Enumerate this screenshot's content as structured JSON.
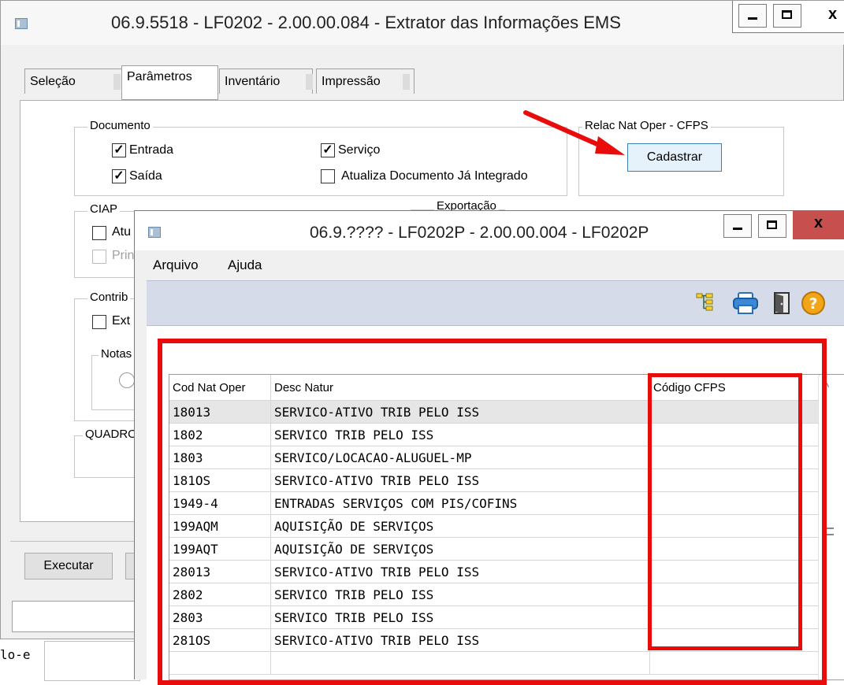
{
  "main_window": {
    "title": "06.9.5518 - LF0202 - 2.00.00.084 - Extrator das Informações EMS",
    "tabs": [
      {
        "label": "Seleção"
      },
      {
        "label": "Parâmetros"
      },
      {
        "label": "Inventário"
      },
      {
        "label": "Impressão"
      }
    ],
    "active_tab": "Parâmetros",
    "documento": {
      "legend": "Documento",
      "entrada": "Entrada",
      "saida": "Saída",
      "servico": "Serviço",
      "atualiza": "Atualiza Documento Já Integrado"
    },
    "relac": {
      "legend": "Relac Nat Oper - CFPS",
      "button": "Cadastrar"
    },
    "ciap": {
      "legend": "CIAP",
      "item1": "Atu",
      "item2": "Prin"
    },
    "exportacao": {
      "legend": "Exportação"
    },
    "contrib": {
      "legend": "Contrib",
      "item1": "Ext",
      "notas": "Notas"
    },
    "quadro": {
      "legend": "QUADRO"
    },
    "executar": "Executar",
    "bg_text": "lo-e"
  },
  "dialog": {
    "title": "06.9.???? - LF0202P - 2.00.00.004 - LF0202P",
    "close_label": "x",
    "menu": [
      "Arquivo",
      "Ajuda"
    ],
    "toolbar_icons": [
      "tree-icon",
      "print-icon",
      "exit-door-icon",
      "help-icon"
    ],
    "columns": [
      "Cod Nat Oper",
      "Desc Natur",
      "Código CFPS"
    ],
    "rows": [
      {
        "cod": "18013",
        "desc": "SERVICO-ATIVO TRIB PELO ISS",
        "cfps": ""
      },
      {
        "cod": "1802",
        "desc": "SERVICO TRIB PELO ISS",
        "cfps": ""
      },
      {
        "cod": "1803",
        "desc": "SERVICO/LOCACAO-ALUGUEL-MP",
        "cfps": ""
      },
      {
        "cod": "181OS",
        "desc": "SERVICO-ATIVO TRIB PELO ISS",
        "cfps": ""
      },
      {
        "cod": "1949-4",
        "desc": "ENTRADAS SERVIÇOS COM PIS/COFINS",
        "cfps": ""
      },
      {
        "cod": "199AQM",
        "desc": "AQUISIÇÃO DE SERVIÇOS",
        "cfps": ""
      },
      {
        "cod": "199AQT",
        "desc": "AQUISIÇÃO DE SERVIÇOS",
        "cfps": ""
      },
      {
        "cod": "28013",
        "desc": "SERVICO-ATIVO TRIB PELO ISS",
        "cfps": ""
      },
      {
        "cod": "2802",
        "desc": "SERVICO TRIB PELO ISS",
        "cfps": ""
      },
      {
        "cod": "2803",
        "desc": "SERVICO TRIB PELO ISS",
        "cfps": ""
      },
      {
        "cod": "281OS",
        "desc": "SERVICO-ATIVO TRIB PELO ISS",
        "cfps": ""
      },
      {
        "cod": "",
        "desc": "",
        "cfps": ""
      }
    ],
    "selected_row": 0
  },
  "colors": {
    "highlight_red": "#e80c0c",
    "close_red": "#c7504f",
    "toolbar_bg": "#d6dbe9"
  }
}
